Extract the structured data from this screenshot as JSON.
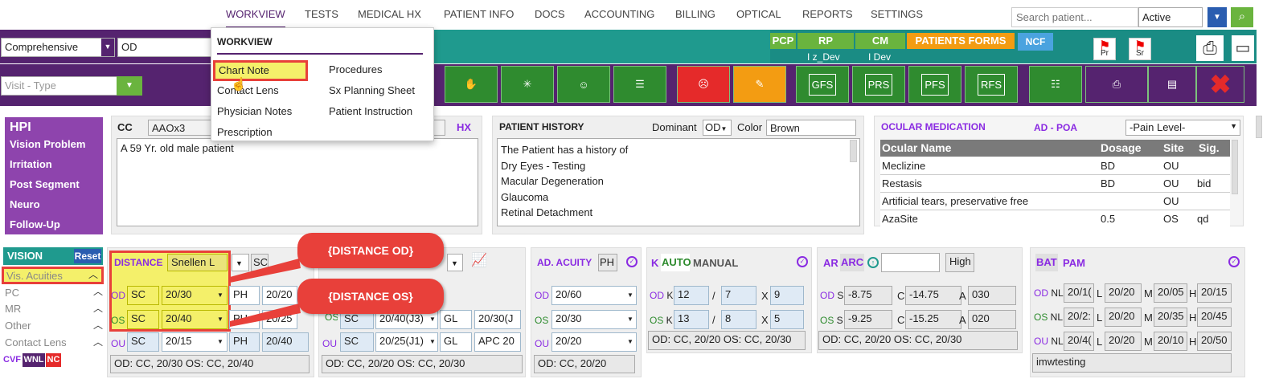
{
  "nav": [
    "WORKVIEW",
    "TESTS",
    "MEDICAL HX",
    "PATIENT INFO",
    "DOCS",
    "ACCOUNTING",
    "BILLING",
    "OPTICAL",
    "REPORTS",
    "SETTINGS"
  ],
  "search_placeholder": "Search patient...",
  "status_value": "Active",
  "exam_type": "Comprehensive",
  "eye": "OD",
  "visit_type_placeholder": "Visit - Type",
  "quick": {
    "pcp": "PCP",
    "rp": "RP",
    "cm": "CM",
    "forms": "PATIENTS FORMS",
    "ncf": "NCF",
    "rp_sub": "I z_Dev",
    "cm_sub": "I Dev",
    "flag_pr": "Pr",
    "flag_sr": "Sr"
  },
  "toolbar": {
    "gfs": "GFS",
    "prs": "PRS",
    "pfs": "PFS",
    "rfs": "RFS"
  },
  "menu": {
    "title": "WORKVIEW",
    "col1": [
      "Chart Note",
      "Contact Lens",
      "Physician Notes",
      "Prescription"
    ],
    "col2": [
      "Procedures",
      "Sx Planning Sheet",
      "Patient Instruction"
    ]
  },
  "hpi": {
    "title": "HPI",
    "items": [
      "Vision Problem",
      "Irritation",
      "Post Segment",
      "Neuro",
      "Follow-Up"
    ]
  },
  "cc": {
    "label": "CC",
    "value": "AAOx3",
    "hx": "HX",
    "text": "A 59 Yr. old male patient"
  },
  "history": {
    "title": "PATIENT HISTORY",
    "dominant_label": "Dominant",
    "dominant": "OD",
    "color_label": "Color",
    "color": "Brown",
    "lines": [
      "The Patient has a history of",
      "Dry Eyes - Testing",
      "Macular Degeneration",
      "Glaucoma",
      "Retinal Detachment"
    ]
  },
  "ocular": {
    "title": "OCULAR MEDICATION",
    "ad_poa": "AD - POA",
    "pain": "-Pain Level-",
    "headers": [
      "Ocular Name",
      "Dosage",
      "Site",
      "Sig."
    ],
    "rows": [
      [
        "Meclizine",
        "BD",
        "OU",
        ""
      ],
      [
        "Restasis",
        "BD",
        "OU",
        "bid"
      ],
      [
        "Artificial tears, preservative free",
        "",
        "OU",
        ""
      ],
      [
        "AzaSite",
        "0.5",
        "OS",
        "qd"
      ]
    ]
  },
  "vision": {
    "title": "VISION",
    "reset": "Reset",
    "items": [
      "Vis. Acuities",
      "PC",
      "MR",
      "Other",
      "Contact Lens"
    ],
    "cvf": "CVF",
    "wnl": "WNL",
    "nc": "NC"
  },
  "distance": {
    "label": "DISTANCE",
    "chart": "Snellen L",
    "sc": "SC",
    "od": "OD",
    "os": "OS",
    "ou": "OU",
    "rows": [
      [
        "SC",
        "20/30",
        "PH",
        "20/20"
      ],
      [
        "SC",
        "20/40",
        "PH",
        "20/25"
      ],
      [
        "SC",
        "20/15",
        "PH",
        "20/40"
      ]
    ],
    "summary": "OD: CC, 20/30 OS: CC, 20/40"
  },
  "near": {
    "rows": [
      [
        "SC",
        "20/40(J3)",
        "GL",
        "20/30(J"
      ],
      [
        "SC",
        "20/25(J1)",
        "GL",
        "APC 20"
      ]
    ],
    "summary": "OD: CC, 20/20 OS: CC, 20/30"
  },
  "ad": {
    "label": "AD. ACUITY",
    "ph": "PH",
    "rows": [
      "20/60",
      "20/30",
      "20/20"
    ],
    "summary": "OD: CC, 20/20"
  },
  "k": {
    "k": "K",
    "auto": "AUTO",
    "manual": "MANUAL",
    "od": [
      "12",
      "7",
      "9"
    ],
    "os": [
      "13",
      "8",
      "5"
    ],
    "summary": "OD: CC, 20/20 OS: CC, 20/30"
  },
  "ar": {
    "ar": "AR",
    "arc": "ARC",
    "high": "High",
    "od": [
      "-8.75",
      "-14.75",
      "030"
    ],
    "os": [
      "-9.25",
      "-15.25",
      "020"
    ],
    "summary": "OD: CC, 20/20 OS: CC, 20/30"
  },
  "bat": {
    "bat": "BAT",
    "pam": "PAM",
    "od": [
      "20/1(",
      "20/20",
      "20/05",
      "20/15"
    ],
    "os": [
      "20/2:",
      "20/20",
      "20/35",
      "20/45"
    ],
    "ou": [
      "20/4(",
      "20/20",
      "20/10",
      "20/50"
    ],
    "note": "imwtesting"
  },
  "callouts": [
    "{DISTANCE OD}",
    "{DISTANCE OS}"
  ],
  "colors": {
    "purple": "#55236f",
    "teal": "#1f9a8e",
    "green": "#2f8b2f",
    "highlight": "#f4f06a"
  }
}
